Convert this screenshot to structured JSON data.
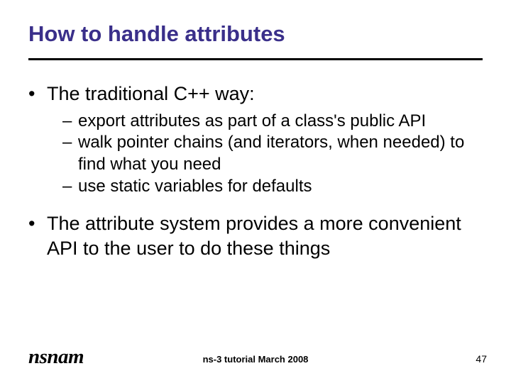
{
  "title": "How to handle attributes",
  "bullets": {
    "b1": "The traditional C++ way:",
    "b1_subs": {
      "s1": "export attributes as part of a class's public API",
      "s2": "walk pointer chains (and iterators, when needed) to find what you need",
      "s3": "use static variables for defaults"
    },
    "b2": "The attribute system provides a more convenient API to the user to do these things"
  },
  "footer": {
    "logo": "nsnam",
    "center": "ns-3 tutorial March 2008",
    "page": "47"
  }
}
